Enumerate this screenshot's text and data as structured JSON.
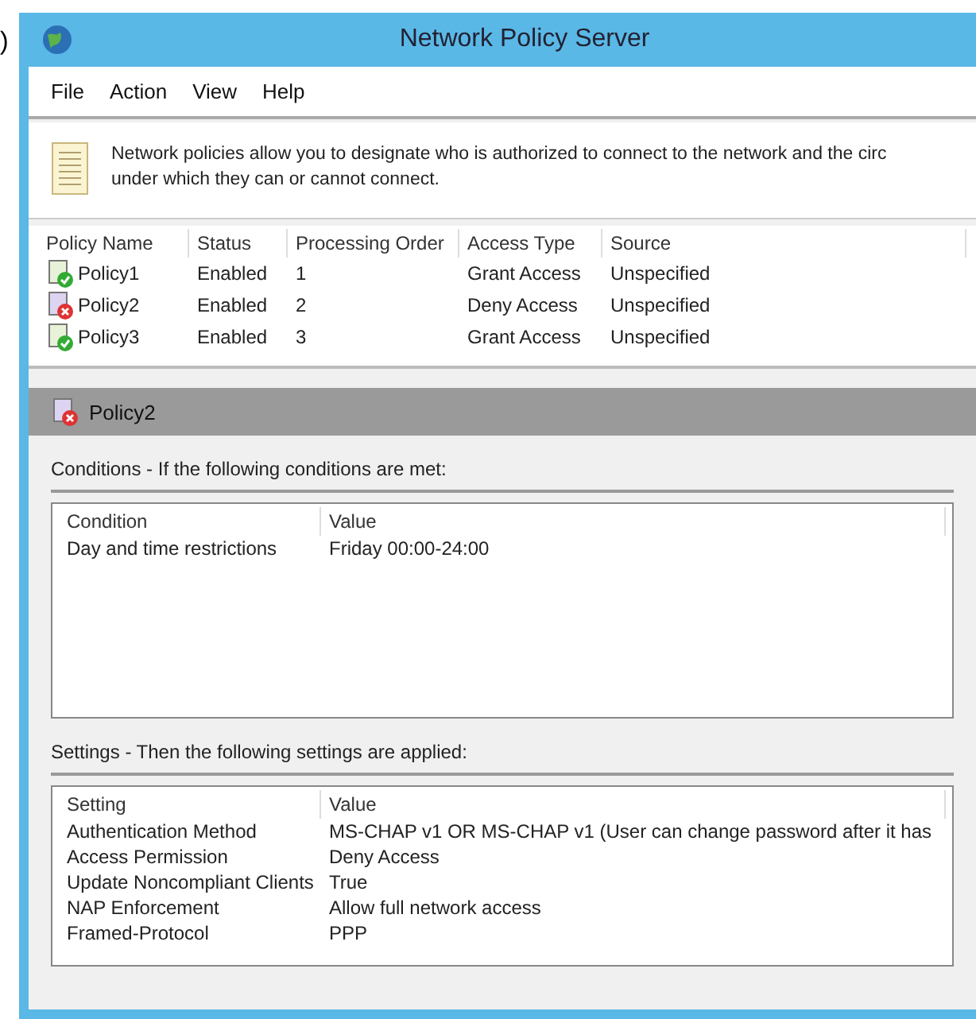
{
  "edge_fragment": ")",
  "window": {
    "title": "Network Policy Server"
  },
  "menu": [
    "File",
    "Action",
    "View",
    "Help"
  ],
  "description": "Network policies allow you to designate who is authorized to connect to the network and the circ\nunder which they can or cannot connect.",
  "policies": {
    "columns": [
      "Policy Name",
      "Status",
      "Processing Order",
      "Access Type",
      "Source"
    ],
    "rows": [
      {
        "kind": "grant",
        "selected": false,
        "cells": [
          "Policy1",
          "Enabled",
          "1",
          "Grant Access",
          "Unspecified"
        ]
      },
      {
        "kind": "deny",
        "selected": false,
        "cells": [
          "Policy2",
          "Enabled",
          "2",
          "Deny Access",
          "Unspecified"
        ]
      },
      {
        "kind": "grant",
        "selected": false,
        "cells": [
          "Policy3",
          "Enabled",
          "3",
          "Grant Access",
          "Unspecified"
        ]
      }
    ]
  },
  "detail": {
    "title": "Policy2",
    "kind": "deny",
    "conditions": {
      "heading": "Conditions - If the following conditions are met:",
      "columns": [
        "Condition",
        "Value"
      ],
      "rows": [
        [
          "Day and time restrictions",
          "Friday 00:00-24:00"
        ]
      ]
    },
    "settings": {
      "heading": "Settings - Then the following settings are applied:",
      "columns": [
        "Setting",
        "Value"
      ],
      "rows": [
        [
          "Authentication Method",
          "MS-CHAP v1 OR MS-CHAP v1 (User can change password after it has"
        ],
        [
          "Access Permission",
          "Deny Access"
        ],
        [
          "Update Noncompliant Clients",
          "True"
        ],
        [
          "NAP Enforcement",
          "Allow full network access"
        ],
        [
          "Framed-Protocol",
          "PPP"
        ]
      ]
    }
  }
}
